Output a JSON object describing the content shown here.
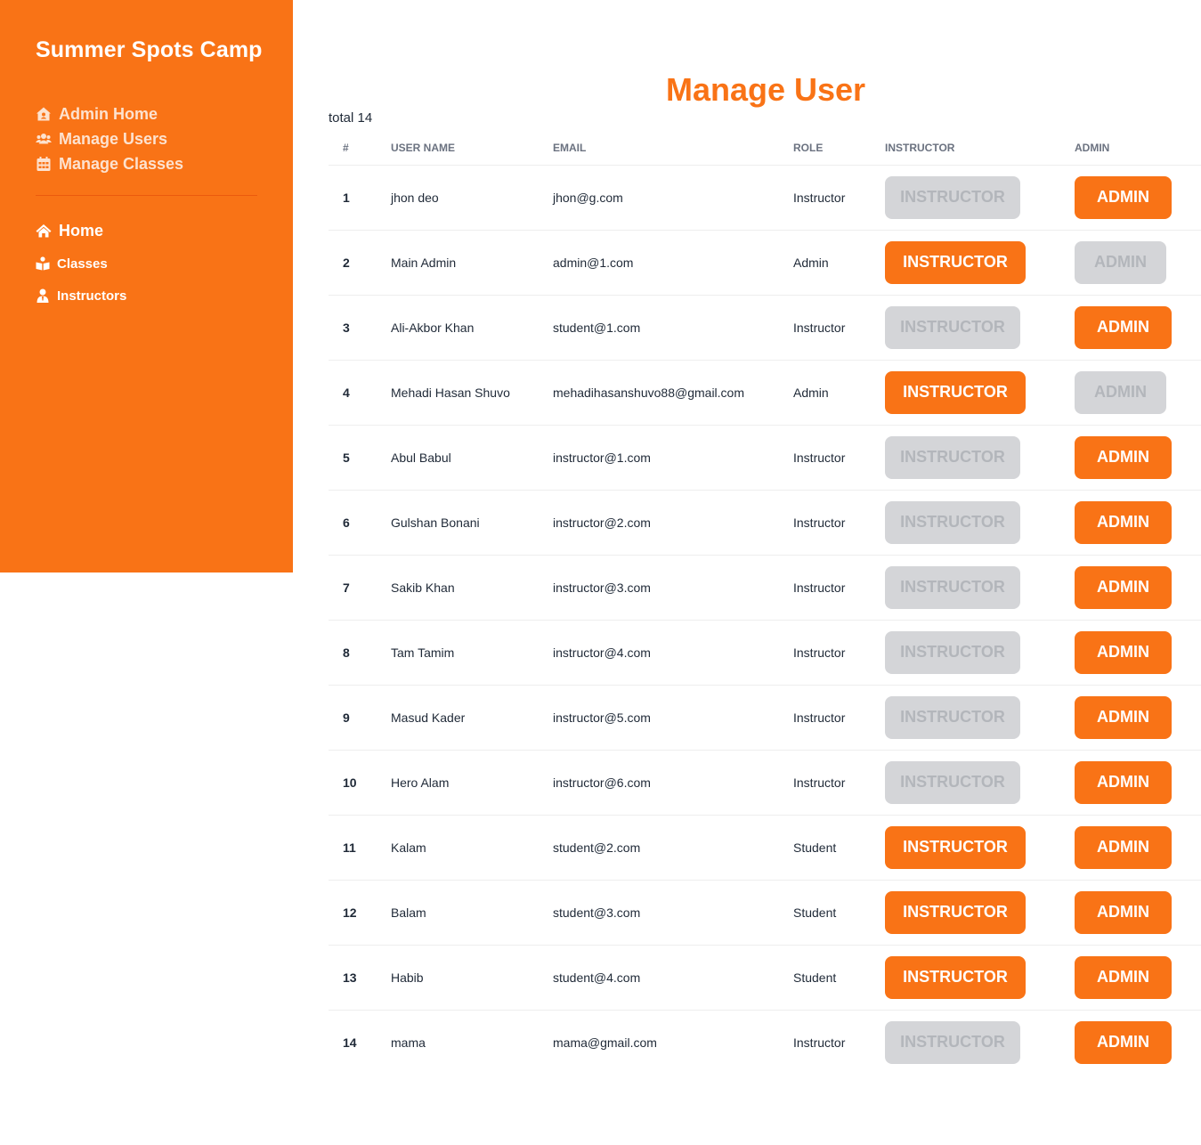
{
  "sidebar": {
    "brand": "Summer Spots Camp",
    "admin_nav": [
      {
        "label": "Admin Home",
        "icon": "house-user-icon"
      },
      {
        "label": "Manage Users",
        "icon": "users-icon"
      },
      {
        "label": "Manage Classes",
        "icon": "calendar-icon"
      }
    ],
    "main_nav": [
      {
        "label": "Home",
        "icon": "home-icon"
      },
      {
        "label": "Classes",
        "icon": "book-reader-icon"
      },
      {
        "label": "Instructors",
        "icon": "user-tie-icon"
      }
    ]
  },
  "main": {
    "title": "Manage User",
    "total": "total 14",
    "columns": [
      "#",
      "User Name",
      "Email",
      "Role",
      "Instructor",
      "Admin"
    ],
    "button_labels": {
      "instructor": "Instructor",
      "admin": "Admin"
    },
    "rows": [
      {
        "num": "1",
        "name": "jhon deo",
        "email": "jhon@g.com",
        "role": "Instructor",
        "instructor_enabled": false,
        "admin_enabled": true
      },
      {
        "num": "2",
        "name": "Main Admin",
        "email": "admin@1.com",
        "role": "Admin",
        "instructor_enabled": true,
        "admin_enabled": false
      },
      {
        "num": "3",
        "name": "Ali-Akbor Khan",
        "email": "student@1.com",
        "role": "Instructor",
        "instructor_enabled": false,
        "admin_enabled": true
      },
      {
        "num": "4",
        "name": "Mehadi Hasan Shuvo",
        "email": "mehadihasanshuvo88@gmail.com",
        "role": "Admin",
        "instructor_enabled": true,
        "admin_enabled": false
      },
      {
        "num": "5",
        "name": "Abul Babul",
        "email": "instructor@1.com",
        "role": "Instructor",
        "instructor_enabled": false,
        "admin_enabled": true
      },
      {
        "num": "6",
        "name": "Gulshan Bonani",
        "email": "instructor@2.com",
        "role": "Instructor",
        "instructor_enabled": false,
        "admin_enabled": true
      },
      {
        "num": "7",
        "name": "Sakib Khan",
        "email": "instructor@3.com",
        "role": "Instructor",
        "instructor_enabled": false,
        "admin_enabled": true
      },
      {
        "num": "8",
        "name": "Tam Tamim",
        "email": "instructor@4.com",
        "role": "Instructor",
        "instructor_enabled": false,
        "admin_enabled": true
      },
      {
        "num": "9",
        "name": "Masud Kader",
        "email": "instructor@5.com",
        "role": "Instructor",
        "instructor_enabled": false,
        "admin_enabled": true
      },
      {
        "num": "10",
        "name": "Hero Alam",
        "email": "instructor@6.com",
        "role": "Instructor",
        "instructor_enabled": false,
        "admin_enabled": true
      },
      {
        "num": "11",
        "name": "Kalam",
        "email": "student@2.com",
        "role": "Student",
        "instructor_enabled": true,
        "admin_enabled": true
      },
      {
        "num": "12",
        "name": "Balam",
        "email": "student@3.com",
        "role": "Student",
        "instructor_enabled": true,
        "admin_enabled": true
      },
      {
        "num": "13",
        "name": "Habib",
        "email": "student@4.com",
        "role": "Student",
        "instructor_enabled": true,
        "admin_enabled": true
      },
      {
        "num": "14",
        "name": "mama",
        "email": "mama@gmail.com",
        "role": "Instructor",
        "instructor_enabled": false,
        "admin_enabled": true
      }
    ]
  },
  "colors": {
    "accent": "#f97316",
    "disabled_bg": "#d4d5d8",
    "disabled_text": "#b3b6bb"
  }
}
